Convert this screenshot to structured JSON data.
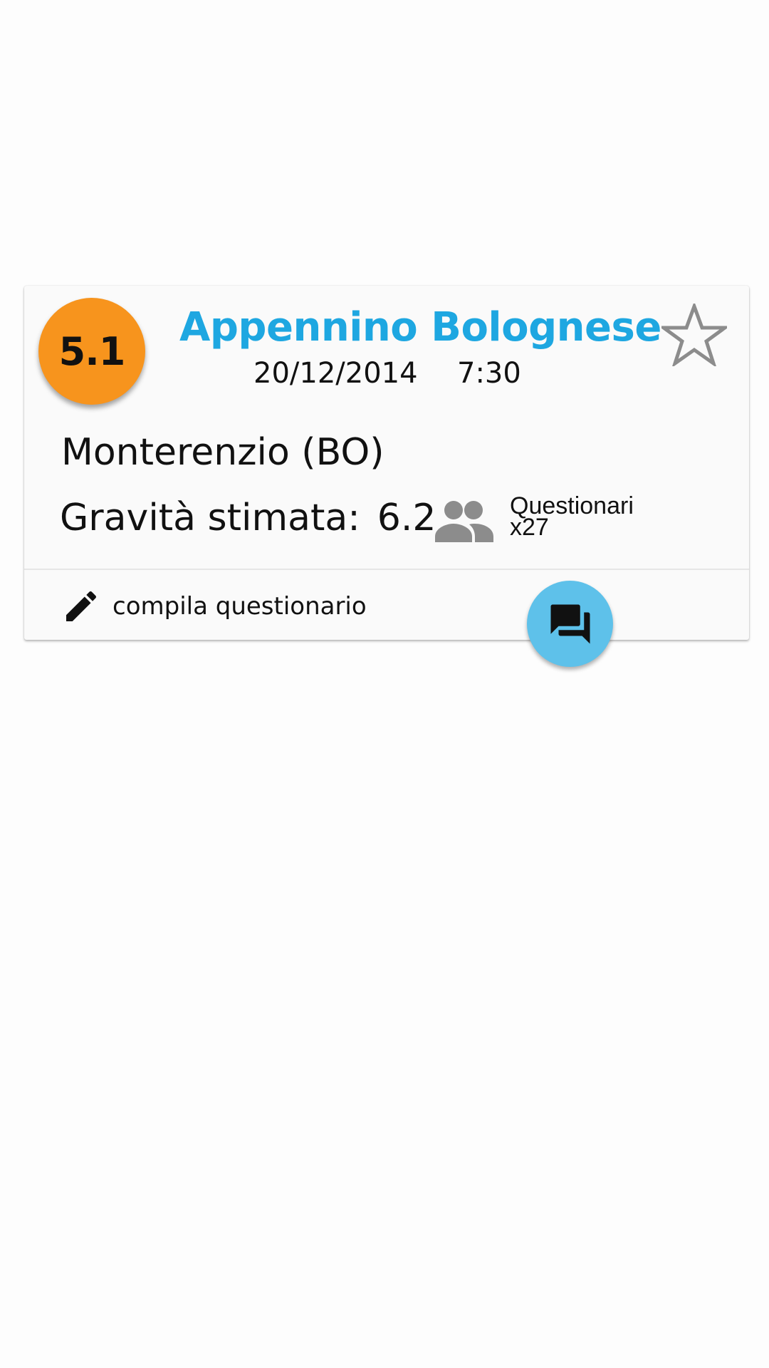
{
  "event": {
    "magnitude": "5.1",
    "region": "Appennino Bolognese",
    "date": "20/12/2014",
    "time": "7:30",
    "location": "Monterenzio (BO)",
    "gravity_label": "Gravità stimata:",
    "gravity_value": "6.2",
    "questionnaires_label": "Questionari",
    "questionnaires_count": "x27"
  },
  "actions": {
    "fill_questionnaire_label": "compila questionario"
  },
  "icons": {
    "favorite": "star-outline-icon",
    "people": "people-icon",
    "edit": "pencil-icon",
    "chat": "forum-icon"
  },
  "colors": {
    "magnitude_badge": "#f7941d",
    "region_title": "#1ea7e1",
    "chat_fab": "#5ec1ea",
    "people_icon": "#8c8c8c",
    "star_icon": "#8c8c8c"
  }
}
